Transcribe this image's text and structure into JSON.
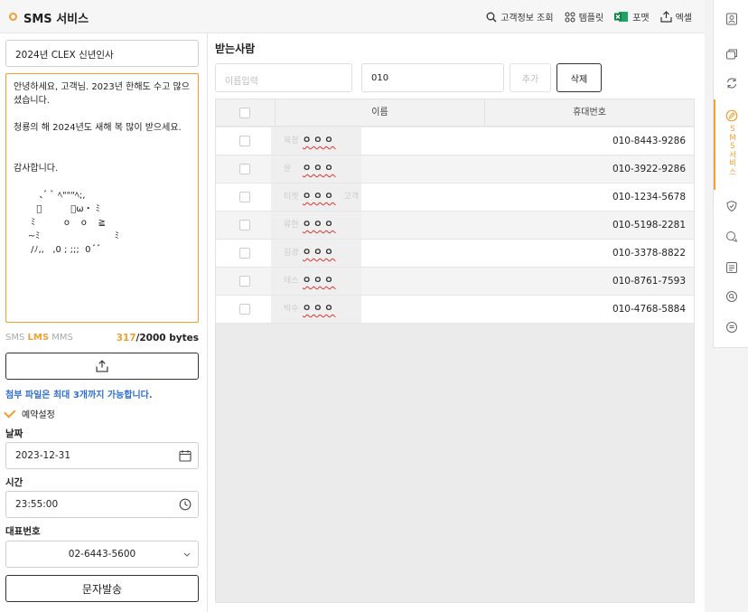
{
  "header": {
    "title": "SMS 서비스",
    "tools": {
      "customer_lookup": "고객정보 조회",
      "template": "템플릿",
      "format": "포맷",
      "excel": "엑셀"
    }
  },
  "compose": {
    "subject": "2024년 CLEX 신년인사",
    "message": "안녕하세요, 고객님. 2023년 한해도 수고 많으\n셨습니다.\n\n청룡의 해 2024년도 새해 복 많이 받으세요.\n\n\n감사합니다.\n\n         ､ﾞ ﾞ ﾍ\"\"\"ﾍ;,\n        ﾞ          ・ω・ ﾐ\n      ﾐ          o    o    ≧\n     ~ﾐ                          ﾐ\n      /ﾉ,,   ,0 ; ;;;  0 ﾞﾞ",
    "types": {
      "sms": "SMS",
      "lms": "LMS",
      "mms": "MMS"
    },
    "bytes_count": "317",
    "bytes_total": "/2000 bytes",
    "attach_note": "첨부 파일은 최대 3개까지 가능합니다.",
    "reserve_label": "예약설정",
    "date_label": "날짜",
    "date_value": "2023-12-31",
    "time_label": "시간",
    "time_value": "23:55:00",
    "rep_label": "대표번호",
    "rep_value": "02-6443-5600",
    "send_label": "문자발송"
  },
  "recipients": {
    "section_title": "받는사람",
    "name_placeholder": "이름입력",
    "phone_value": "010",
    "add_label": "추가",
    "delete_label": "삭제",
    "columns": {
      "name": "이름",
      "phone": "휴대번호"
    },
    "mask": "ㅇㅇㅇ",
    "rows": [
      {
        "prefix": "육정",
        "phone": "010-8443-9286"
      },
      {
        "prefix": "윤",
        "phone": "010-3922-9286"
      },
      {
        "prefix": "티켓",
        "suffix": "고객",
        "phone": "010-1234-5678"
      },
      {
        "prefix": "류현",
        "phone": "010-5198-2281"
      },
      {
        "prefix": "김경",
        "phone": "010-3378-8822"
      },
      {
        "prefix": "테스",
        "phone": "010-8761-7593"
      },
      {
        "prefix": "박수",
        "phone": "010-4768-5884"
      }
    ]
  },
  "sidebar": {
    "active_label": "SMS서비스",
    "accent": "#f0a030"
  }
}
